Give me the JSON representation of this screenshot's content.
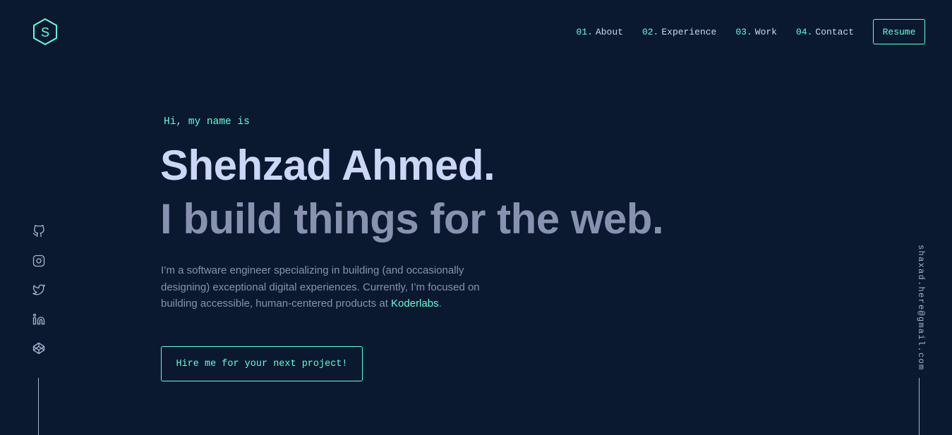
{
  "logo": {
    "letter": "S",
    "icon": "hexagon-logo-icon"
  },
  "nav": {
    "items": [
      {
        "num": "01.",
        "label": "About"
      },
      {
        "num": "02.",
        "label": "Experience"
      },
      {
        "num": "03.",
        "label": "Work"
      },
      {
        "num": "04.",
        "label": "Contact"
      }
    ],
    "resume_label": "Resume"
  },
  "socials": [
    "github-icon",
    "instagram-icon",
    "twitter-icon",
    "linkedin-icon",
    "codepen-icon"
  ],
  "email": "shaxad.here@gmail.com",
  "hero": {
    "intro": "Hi, my name is",
    "name": "Shehzad Ahmed.",
    "tagline": "I build things for the web.",
    "bio_before": "I’m a software engineer specializing in building (and occasionally designing) exceptional digital experiences. Currently, I’m focused on building accessible, human-centered products at ",
    "bio_link": "Koderlabs",
    "bio_after": ".",
    "cta_label": "Hire me for your next project!"
  },
  "colors": {
    "background": "#0a192f",
    "accent": "#64ffda",
    "heading": "#ccd6f6",
    "text": "#8892b0",
    "light": "#a8b2d1"
  }
}
